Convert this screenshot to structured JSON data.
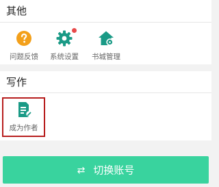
{
  "sections": {
    "other": {
      "title": "其他",
      "items": [
        {
          "label": "问题反馈",
          "icon": "question-circle-icon"
        },
        {
          "label": "系统设置",
          "icon": "gear-icon",
          "badge": true
        },
        {
          "label": "书城管理",
          "icon": "house-gear-icon"
        }
      ]
    },
    "write": {
      "title": "写作",
      "items": [
        {
          "label": "成为作者",
          "icon": "document-pen-icon",
          "highlighted": true
        }
      ]
    }
  },
  "switch_button": {
    "icon": "swap-arrows-icon",
    "label": "切换账号"
  },
  "colors": {
    "accent_green": "#39d39e",
    "icon_teal": "#1a9a86",
    "icon_orange": "#f3a01b",
    "badge_red": "#e84a4a",
    "highlight_border": "#b71d1d"
  }
}
